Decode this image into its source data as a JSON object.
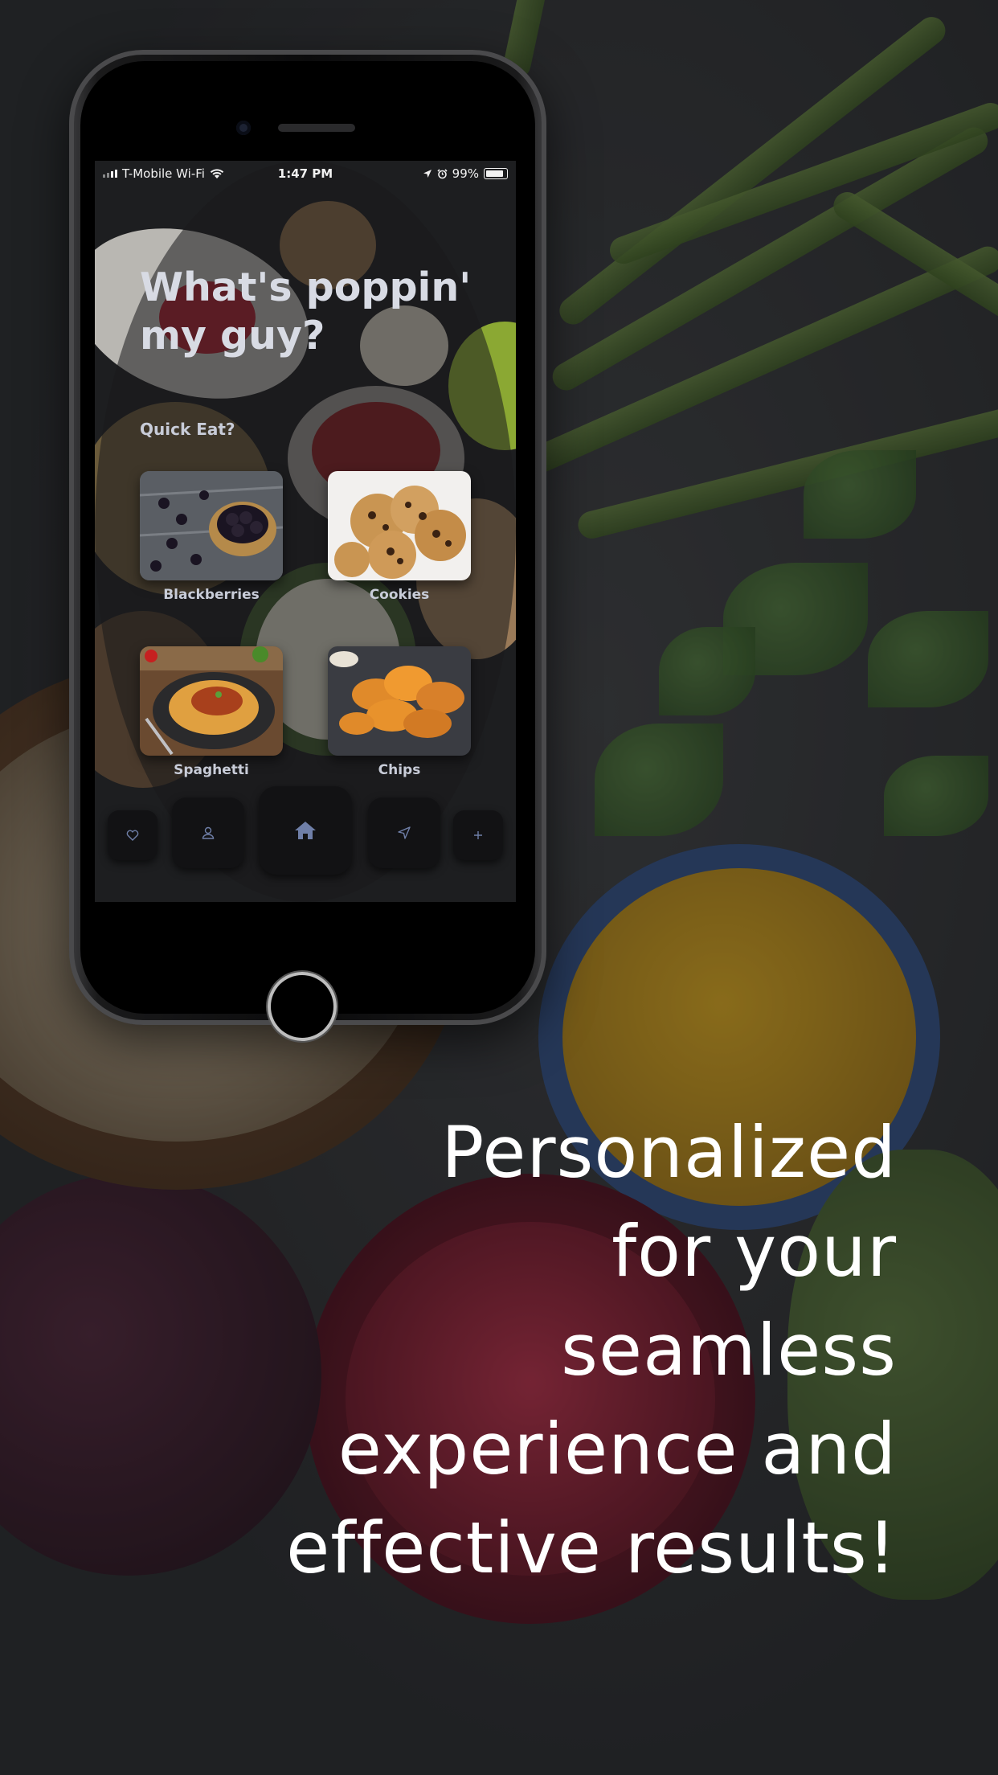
{
  "status_bar": {
    "carrier": "T-Mobile Wi-Fi",
    "time": "1:47 PM",
    "battery": "99%"
  },
  "screen": {
    "greeting_line1": "What's poppin'",
    "greeting_line2": "my guy?",
    "section_label": "Quick Eat?",
    "foods": [
      {
        "label": "Blackberries",
        "icon": "blackberries-image"
      },
      {
        "label": "Cookies",
        "icon": "cookies-image"
      },
      {
        "label": "Spaghetti",
        "icon": "spaghetti-image"
      },
      {
        "label": "Chips",
        "icon": "chips-image"
      }
    ],
    "nav_icons": [
      "heart-icon",
      "user-icon",
      "home-icon",
      "location-arrow-icon",
      "plus-icon"
    ]
  },
  "headline": {
    "lines": [
      "Personalized",
      "for your",
      "seamless",
      "experience and",
      "effective results!"
    ]
  },
  "colors": {
    "accent": "#6f7fa8",
    "text_light": "#d8dbe4",
    "background": "#2b2d2f"
  }
}
